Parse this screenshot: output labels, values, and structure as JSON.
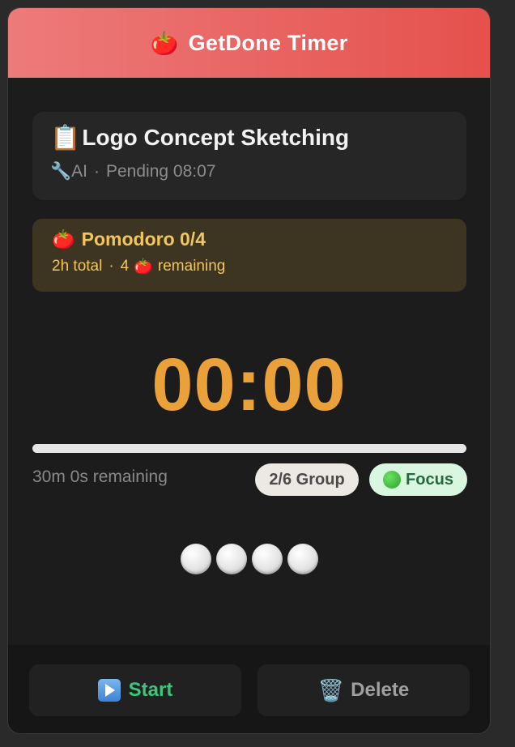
{
  "header": {
    "icon": "tomato-icon",
    "icon_glyph": "🍅",
    "title": "GetDone Timer"
  },
  "task": {
    "icon": "clipboard-icon",
    "icon_glyph": "📋",
    "title": "Logo Concept Sketching",
    "category_icon": "wrench-icon",
    "category_glyph": "🔧",
    "category": "AI",
    "separator": "·",
    "status": "Pending 08:07"
  },
  "pomodoro": {
    "icon_glyph": "🍅",
    "title": "Pomodoro 0/4",
    "total": "2h total",
    "separator": "·",
    "remaining_count": "4",
    "remaining_glyph": "🍅",
    "remaining_label": "remaining"
  },
  "timer": {
    "display": "00:00",
    "progress_fraction": 1.0
  },
  "status": {
    "remaining_text": "30m 0s remaining",
    "group_badge": "2/6 Group",
    "mode_badge": "Focus"
  },
  "session_circles": [
    "⚪",
    "⚪",
    "⚪",
    "⚪"
  ],
  "actions": {
    "start_label": "Start",
    "delete_glyph": "🗑️",
    "delete_label": "Delete"
  },
  "colors": {
    "header_gradient_start": "#ec7b7a",
    "header_gradient_end": "#e5514d",
    "timer": "#eaa13a",
    "pomodoro_text": "#f2c55e",
    "start": "#3ec47b"
  }
}
